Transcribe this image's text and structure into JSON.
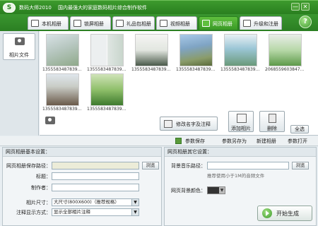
{
  "titlebar": {
    "app_title": "数码大师2010",
    "subtitle": "国内最强大的家庭数码相片综合制作软件",
    "logo": "S",
    "minimize": "—",
    "close": "✕"
  },
  "tabs": [
    {
      "label": "本机相册"
    },
    {
      "label": "锁屏相册"
    },
    {
      "label": "礼品包相册"
    },
    {
      "label": "视频相册"
    },
    {
      "label": "网页相册"
    },
    {
      "label": "升级和注册"
    }
  ],
  "help_label": "?",
  "sidebar": {
    "items": [
      {
        "label": "相片文件"
      }
    ]
  },
  "gallery": {
    "photos": [
      {
        "caption": "1355583487839..."
      },
      {
        "caption": "1355583487839..."
      },
      {
        "caption": "1355583487839..."
      },
      {
        "caption": "1355583487839..."
      },
      {
        "caption": "1355583487839..."
      },
      {
        "caption": "2068559603847..."
      },
      {
        "caption": "1355583487839..."
      },
      {
        "caption": "1355583487839..."
      }
    ],
    "edit_info_label": "修改名字及注释",
    "add_photo_label": "添加相片",
    "delete_label": "删除",
    "select_all_label": "全选"
  },
  "toolbar2": {
    "save_params": "参数保存",
    "save_params_as": "参数另存为",
    "new_album": "新建相册",
    "open_params": "参数打开"
  },
  "left_panel": {
    "title": "网页相册基本设置：",
    "save_path_label": "网页相册保存路径：",
    "save_path_value": "",
    "browse_label": "浏览",
    "heading_label": "标题：",
    "heading_value": "",
    "author_label": "制作者：",
    "author_value": "",
    "size_label": "相片尺寸：",
    "size_value": "大尺寸(800X600)（推荐规格）",
    "comment_mode_label": "注释显示方式：",
    "comment_mode_value": "显示全部相片注释"
  },
  "right_panel": {
    "title": "网页相册其它设置：",
    "music_label": "背景音乐路径：",
    "music_value": "",
    "browse_label": "浏览",
    "music_hint": "推荐使用小于1M的音频文件",
    "bg_color_label": "网页背景颜色：",
    "bg_color": "#333333"
  },
  "generate_label": "开始生成",
  "colors": {
    "title_green": "#2a7f1f",
    "active_tab_green": "#3a9a26",
    "panel_bg": "#f2f5f7"
  }
}
